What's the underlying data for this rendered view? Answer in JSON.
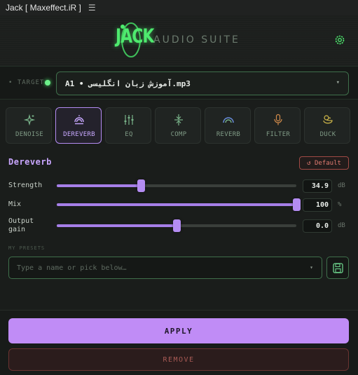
{
  "window": {
    "title": "Jack [ Maxeffect.iR ]",
    "menu_icon": "hamburger-icon"
  },
  "header": {
    "logo_text": "JACK",
    "suite_label": "AUDIO SUITE",
    "settings_icon": "gear-icon"
  },
  "target": {
    "label": "• TARGET",
    "status_color": "#6cf08a",
    "value": "A1 • آموزش زبان انگلیسی.mp3",
    "dropdown_icon": "caret-down-icon"
  },
  "tabs": [
    {
      "id": "denoise",
      "label": "DENOISE",
      "icon": "sparkle-icon",
      "active": false
    },
    {
      "id": "dereverb",
      "label": "DEREVERB",
      "icon": "dereverb-icon",
      "active": true
    },
    {
      "id": "eq",
      "label": "EQ",
      "icon": "eq-sliders-icon",
      "active": false
    },
    {
      "id": "comp",
      "label": "COMP",
      "icon": "compress-icon",
      "active": false
    },
    {
      "id": "reverb",
      "label": "REVERB",
      "icon": "rainbow-icon",
      "active": false
    },
    {
      "id": "filter",
      "label": "FILTER",
      "icon": "microphone-icon",
      "active": false
    },
    {
      "id": "duck",
      "label": "DUCK",
      "icon": "duck-icon",
      "active": false
    }
  ],
  "panel": {
    "title": "Dereverb",
    "default_button": "↺ Default",
    "controls": [
      {
        "name": "Strength",
        "value": "34.9",
        "unit": "dB",
        "fraction": 0.35
      },
      {
        "name": "Mix",
        "value": "100",
        "unit": "%",
        "fraction": 1.0
      },
      {
        "name": "Output\ngain",
        "value": "0.0",
        "unit": "dB",
        "fraction": 0.5
      }
    ]
  },
  "presets": {
    "label": "MY PRESETS",
    "placeholder": "Type a name or pick below…",
    "save_icon": "save-icon"
  },
  "actions": {
    "apply": "APPLY",
    "remove": "REMOVE"
  },
  "colors": {
    "accent": "#c08cf6",
    "green": "#4eea6e",
    "danger": "#e07a70"
  }
}
